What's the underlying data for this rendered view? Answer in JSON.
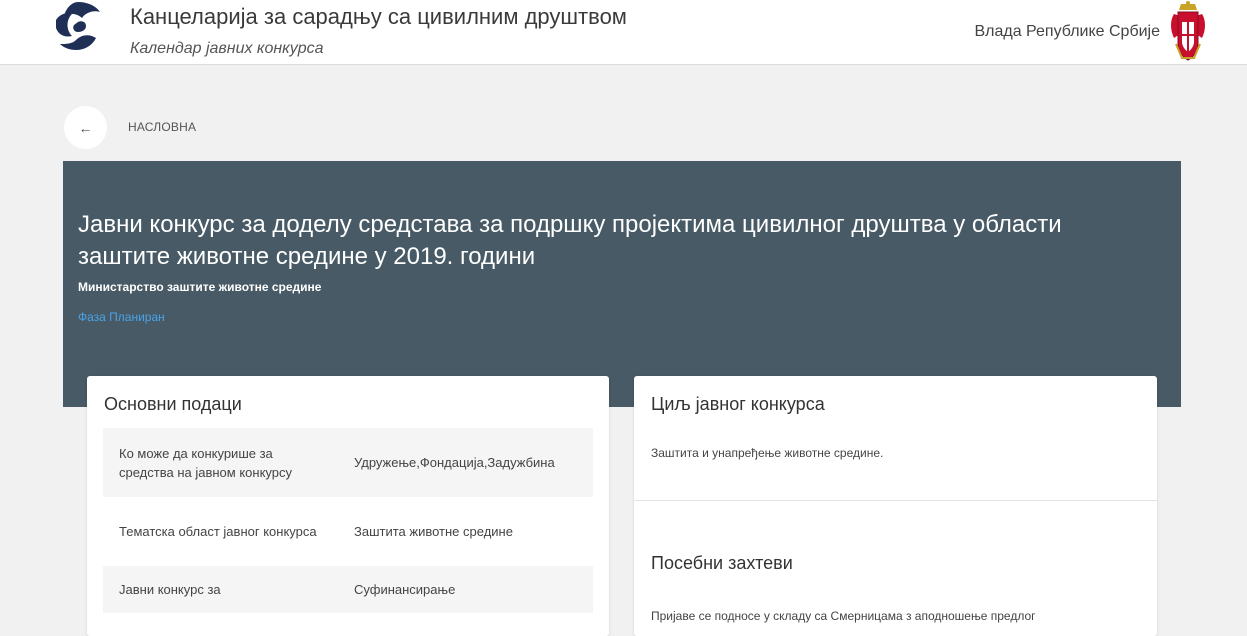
{
  "header": {
    "org_title": "Канцеларија за сарадњу са цивилним друштвом",
    "org_subtitle": "Календар јавних конкурса",
    "gov_label": "Влада Републике Србије"
  },
  "nav": {
    "back_icon": "←",
    "breadcrumb": "НАСЛОВНА"
  },
  "hero": {
    "title": "Јавни конкурс за доделу средстава за подршку пројектима цивилног друштва у области заштите животне средине у 2019. години",
    "ministry": "Министарство заштите животне средине",
    "phase": "Фаза Планиран"
  },
  "basic_info": {
    "heading": "Основни подаци",
    "rows": [
      {
        "label": "Ко може да конкурише за средства на јавном конкурсу",
        "value": "Удружење,Фондација,Задужбина"
      },
      {
        "label": "Тематска област јавног конкурса",
        "value": "Заштита животне средине"
      },
      {
        "label": "Јавни конкурс за",
        "value": "Суфинансирање"
      }
    ]
  },
  "goal": {
    "heading": "Циљ јавног конкурса",
    "text": "Заштита и унапређење животне средине."
  },
  "requirements": {
    "heading": "Посебни захтеви",
    "text": "Пријаве се подносе у складу са Смерницама з аподношење предлог"
  },
  "colors": {
    "hero_bg": "#475a65",
    "phase_link": "#4aa3e8",
    "page_bg": "#f1f1f1"
  },
  "icons": [
    "logo-icon",
    "coat-of-arms-icon",
    "back-arrow-icon"
  ]
}
